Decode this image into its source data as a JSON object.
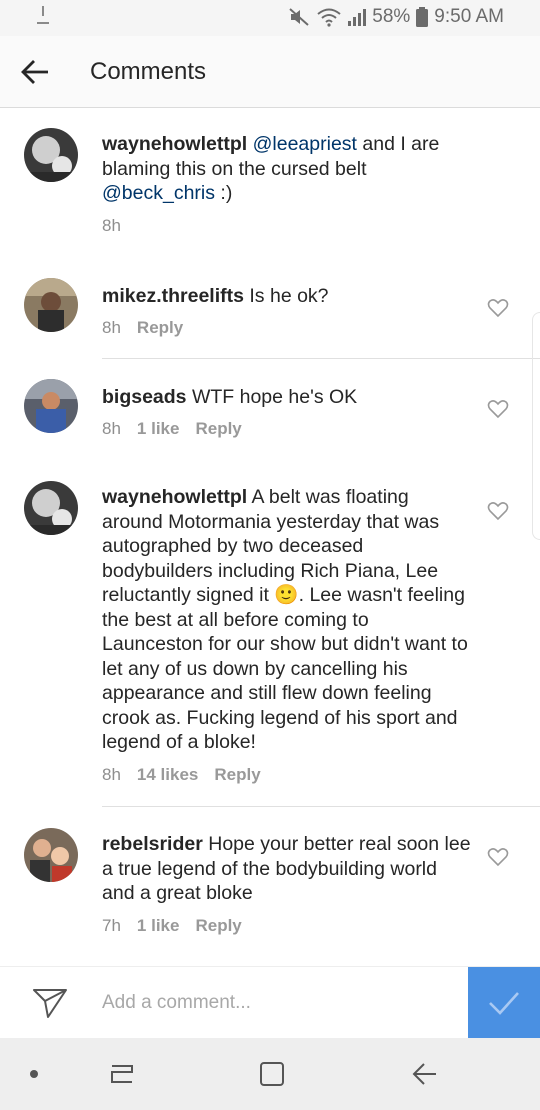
{
  "statusbar": {
    "battery": "58%",
    "time": "9:50 AM"
  },
  "header": {
    "title": "Comments"
  },
  "comments": [
    {
      "username": "waynehowlettpl",
      "parts": [
        {
          "t": "mention",
          "v": "@leeapriest"
        },
        {
          "t": "text",
          "v": " and I are blaming this on the cursed belt "
        },
        {
          "t": "mention",
          "v": "@beck_chris"
        },
        {
          "t": "text",
          "v": " :)"
        }
      ],
      "time": "8h",
      "likes": "",
      "reply": ""
    },
    {
      "username": "mikez.threelifts",
      "parts": [
        {
          "t": "text",
          "v": " Is he ok?"
        }
      ],
      "time": "8h",
      "likes": "",
      "reply": "Reply"
    },
    {
      "username": "bigseads",
      "parts": [
        {
          "t": "text",
          "v": " WTF hope he's OK"
        }
      ],
      "time": "8h",
      "likes": "1 like",
      "reply": "Reply"
    },
    {
      "username": "waynehowlettpl",
      "parts": [
        {
          "t": "text",
          "v": " A belt was floating around Motormania yesterday that was autographed by two deceased bodybuilders including Rich Piana, Lee reluctantly signed it 🙂. Lee wasn't feeling the best at all before coming to Launceston for our show but didn't want to let any of us down by cancelling his appearance and still flew down feeling crook as. Fucking legend of his sport and legend of a bloke!"
        }
      ],
      "time": "8h",
      "likes": "14 likes",
      "reply": "Reply"
    },
    {
      "username": "rebelsrider",
      "parts": [
        {
          "t": "text",
          "v": " Hope your better real soon lee a true legend of the bodybuilding world and a great bloke"
        }
      ],
      "time": "7h",
      "likes": "1 like",
      "reply": "Reply"
    }
  ],
  "composer": {
    "placeholder": "Add a comment..."
  },
  "colors": {
    "accent": "#4a90e2",
    "mention": "#003569"
  }
}
